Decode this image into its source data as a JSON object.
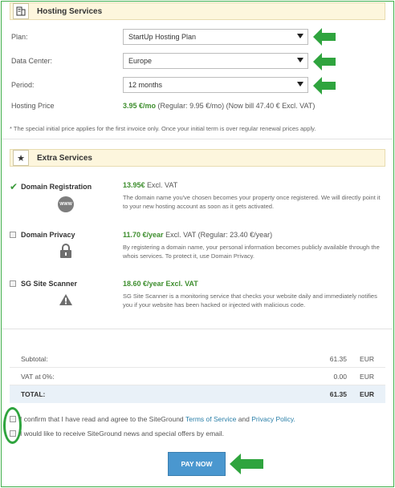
{
  "hosting": {
    "title": "Hosting Services",
    "plan_label": "Plan:",
    "plan_value": "StartUp Hosting Plan",
    "datacenter_label": "Data Center:",
    "datacenter_value": "Europe",
    "period_label": "Period:",
    "period_value": "12 months",
    "price_label": "Hosting Price",
    "price_value": "3.95 €/mo",
    "price_regular": "(Regular: 9.95 €/mo)",
    "price_bill": "(Now bill 47.40 € Excl. VAT)",
    "note": "* The special initial price applies for the first invoice only. Once your initial term is over regular renewal prices apply."
  },
  "extras": {
    "title": "Extra Services",
    "items": [
      {
        "name": "Domain Registration",
        "price": "13.95€",
        "price_suffix": "Excl. VAT",
        "icon_text": "WWW",
        "description": "The domain name you've chosen becomes your property once registered. We will directly point it to your new hosting account as soon as it gets activated."
      },
      {
        "name": "Domain Privacy",
        "price": "11.70 €/year",
        "price_suffix": "Excl. VAT (Regular: 23.40 €/year)",
        "description": "By registering a domain name, your personal information becomes publicly available through the whois services. To protect it, use Domain Privacy."
      },
      {
        "name": "SG Site Scanner",
        "price": "18.60 €/year Excl. VAT",
        "price_suffix": "",
        "description": "SG Site Scanner is a monitoring service that checks your website daily and immediately notifies you if your website has been hacked or injected with malicious code."
      }
    ]
  },
  "summary": {
    "subtotal_label": "Subtotal:",
    "subtotal_value": "61.35",
    "vat_label": "VAT at 0%:",
    "vat_value": "0.00",
    "total_label": "TOTAL:",
    "total_value": "61.35",
    "currency": "EUR"
  },
  "agreements": {
    "tos_prefix": "I confirm that I have read and agree to the SiteGround",
    "tos_link": "Terms of Service",
    "tos_and": "and",
    "privacy_link": "Privacy Policy.",
    "news": "I would like to receive SiteGround news and special offers by email."
  },
  "pay_button": "PAY NOW",
  "colors": {
    "annotation_green": "#2fa43e",
    "price_green": "#3e8e2e",
    "link_blue": "#2a7fa8",
    "button_blue": "#4a97cf"
  }
}
